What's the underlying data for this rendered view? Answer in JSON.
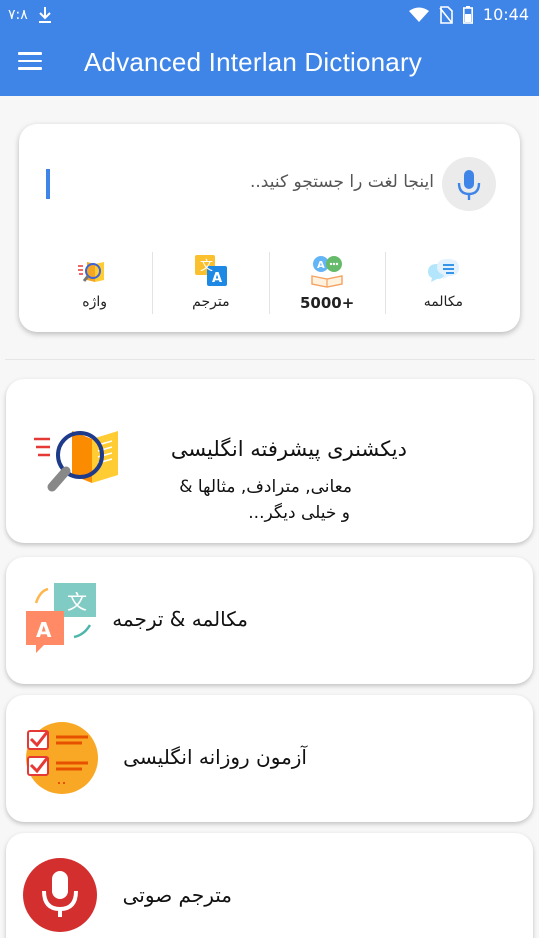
{
  "status_bar": {
    "left_text": "۷:۸",
    "time": "10:44"
  },
  "app_bar": {
    "title": "Advanced Interlan Dictionary",
    "menu_icon": "hamburger-menu-icon"
  },
  "search": {
    "placeholder": "اینجا لغت را جستجو کنید..",
    "mic_icon": "microphone-icon"
  },
  "quick_actions": [
    {
      "label": "واژه",
      "icon": "book-dictionary-icon"
    },
    {
      "label": "مترجم",
      "icon": "translate-icon"
    },
    {
      "label": "5000+",
      "icon": "conversation-book-icon"
    },
    {
      "label": "مکالمه",
      "icon": "chat-bubbles-icon"
    }
  ],
  "features": [
    {
      "title": "دیکشنری پیشرفته انگلیسی",
      "subtitle_line1": "معانی, مترادف, مثالها &",
      "subtitle_line2": "و خیلی دیگر..."
    },
    {
      "title": "مکالمه & ترجمه"
    },
    {
      "title": "آزمون روزانه انگلیسی"
    },
    {
      "title": "مترجم صوتی"
    }
  ],
  "colors": {
    "primary": "#3f85e8",
    "mic_red": "#d32f2f",
    "quiz_orange": "#f9a825"
  }
}
